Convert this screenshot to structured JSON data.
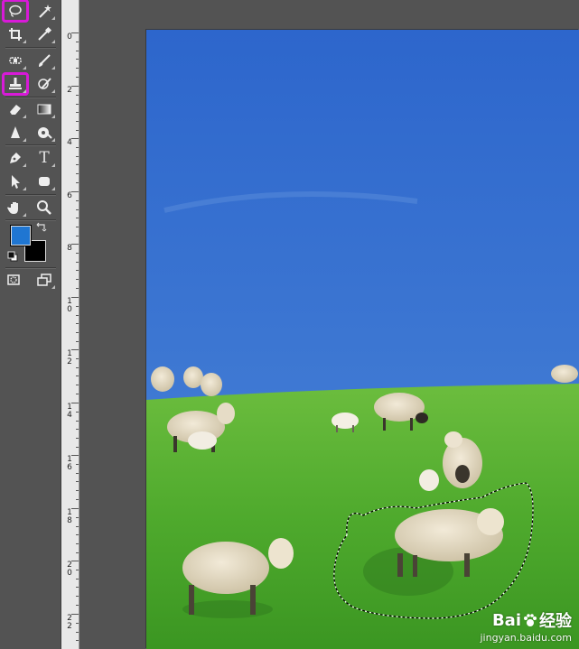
{
  "toolbar": {
    "tools": [
      {
        "id": "lasso",
        "icon": "lasso-icon",
        "highlighted": true
      },
      {
        "id": "magic-wand",
        "icon": "magic-wand-icon"
      },
      {
        "id": "crop",
        "icon": "crop-icon"
      },
      {
        "id": "eyedropper",
        "icon": "eyedropper-icon"
      },
      {
        "id": "healing-brush",
        "icon": "healing-brush-icon"
      },
      {
        "id": "brush",
        "icon": "brush-icon"
      },
      {
        "id": "clone-stamp",
        "icon": "clone-stamp-icon",
        "highlighted": true
      },
      {
        "id": "history-brush",
        "icon": "history-brush-icon"
      },
      {
        "id": "eraser",
        "icon": "eraser-icon"
      },
      {
        "id": "gradient",
        "icon": "gradient-icon"
      },
      {
        "id": "blur",
        "icon": "blur-icon"
      },
      {
        "id": "dodge",
        "icon": "dodge-icon"
      },
      {
        "id": "pen",
        "icon": "pen-icon"
      },
      {
        "id": "type",
        "icon": "type-icon"
      },
      {
        "id": "path-selection",
        "icon": "path-selection-icon"
      },
      {
        "id": "shape",
        "icon": "rectangle-shape-icon"
      },
      {
        "id": "hand",
        "icon": "hand-icon"
      },
      {
        "id": "zoom",
        "icon": "zoom-icon"
      }
    ],
    "type_glyph": "T",
    "foreground_color": "#1f76d2",
    "background_color": "#000000",
    "highlight_color": "#d81ad8"
  },
  "ruler": {
    "labels": [
      "0",
      "2",
      "4",
      "6",
      "8",
      "1\n0",
      "1\n2",
      "1\n4",
      "1\n6",
      "1\n8",
      "2\n0",
      "2\n2"
    ]
  },
  "watermark": {
    "brand": "Bai",
    "brand2": "经验",
    "url": "jingyan.baidu.com"
  }
}
